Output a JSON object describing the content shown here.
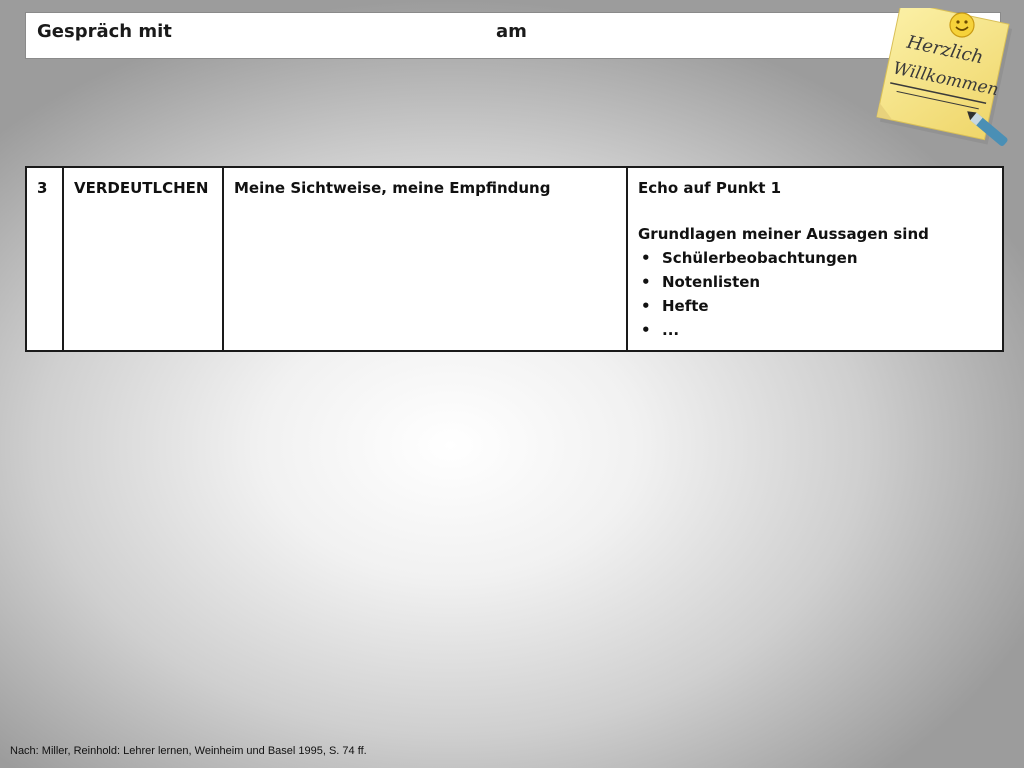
{
  "header": {
    "left_label": "Gespräch mit",
    "right_label": "am"
  },
  "sticky_note": {
    "line1": "Herzlich",
    "line2": "Willkommen",
    "icon": "smiley-face-icon",
    "note_color": "#f6e58a",
    "pen_color": "#4a8fb5"
  },
  "table": {
    "row": {
      "number": "3",
      "phase": "VERDEUTLCHEN",
      "focus": "Meine Sichtweise, meine Empfindung",
      "detail_title": "Echo auf Punkt 1",
      "detail_subtitle": "Grundlagen meiner Aussagen sind",
      "bullets": [
        "Schülerbeobachtungen",
        "Notenlisten",
        "Hefte",
        "..."
      ]
    }
  },
  "footer": {
    "citation": "Nach: Miller, Reinhold: Lehrer lernen, Weinheim und Basel 1995, S. 74 ff."
  }
}
